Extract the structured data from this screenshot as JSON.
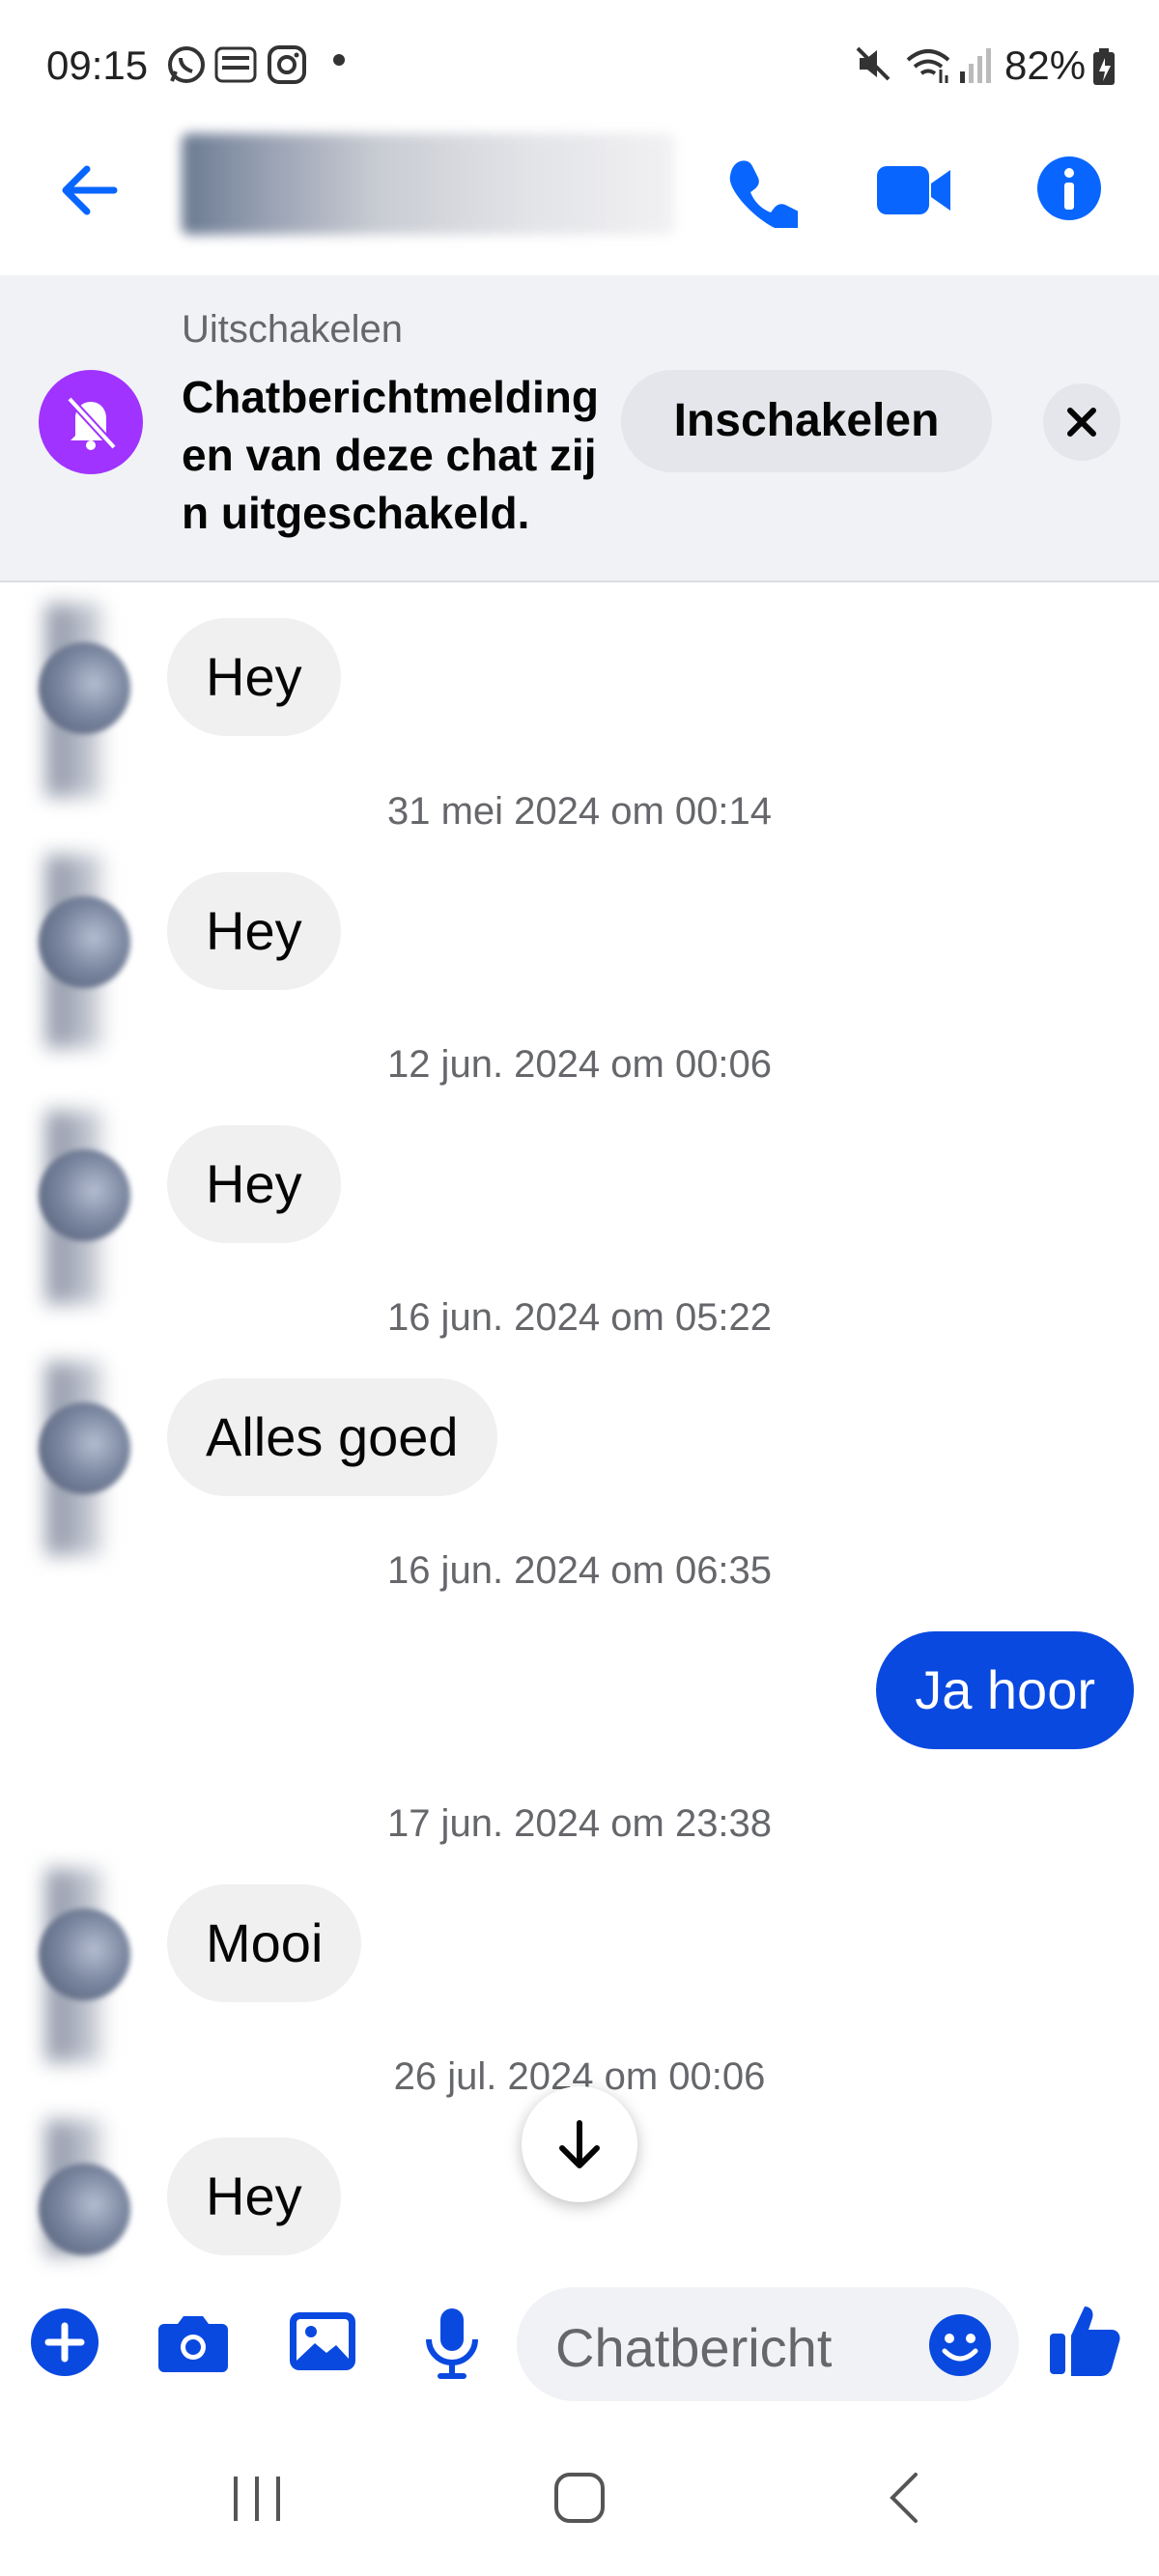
{
  "status_bar": {
    "time": "09:15",
    "left_icons": [
      "whatsapp-icon",
      "temu-icon",
      "instagram-icon"
    ],
    "right_icons": [
      "mute-icon",
      "wifi-icon",
      "signal-icon",
      "battery-icon"
    ],
    "battery": "82%"
  },
  "header": {
    "icons": [
      "back-arrow-icon",
      "phone-icon",
      "video-camera-icon",
      "info-icon"
    ],
    "accent_color": "#0866ff"
  },
  "mute_banner": {
    "title": "Uitschakelen",
    "text": "Chatberichtmeldingen van deze chat zijn uitgeschakeld.",
    "button": "Inschakelen",
    "icon_color": "#a033ff"
  },
  "messages": [
    {
      "type": "in",
      "text": "Hey"
    },
    {
      "type": "time",
      "text": "31 mei 2024 om 00:14"
    },
    {
      "type": "in",
      "text": "Hey"
    },
    {
      "type": "time",
      "text": "12 jun. 2024 om 00:06"
    },
    {
      "type": "in",
      "text": "Hey"
    },
    {
      "type": "time",
      "text": "16 jun. 2024 om 05:22"
    },
    {
      "type": "in",
      "text": "Alles goed"
    },
    {
      "type": "time",
      "text": "16 jun. 2024 om 06:35"
    },
    {
      "type": "out",
      "text": "Ja hoor"
    },
    {
      "type": "time",
      "text": "17 jun. 2024 om 23:38"
    },
    {
      "type": "in",
      "text": "Mooi"
    },
    {
      "type": "time",
      "text": "26 jul. 2024 om 00:06"
    },
    {
      "type": "in",
      "text": "Hey"
    }
  ],
  "composer": {
    "placeholder": "Chatbericht",
    "icons": [
      "plus-icon",
      "camera-icon",
      "gallery-icon",
      "microphone-icon",
      "emoji-icon",
      "thumbs-up-icon"
    ]
  },
  "nav_bar": {
    "icons": [
      "recent-apps-icon",
      "home-icon",
      "back-icon"
    ]
  }
}
